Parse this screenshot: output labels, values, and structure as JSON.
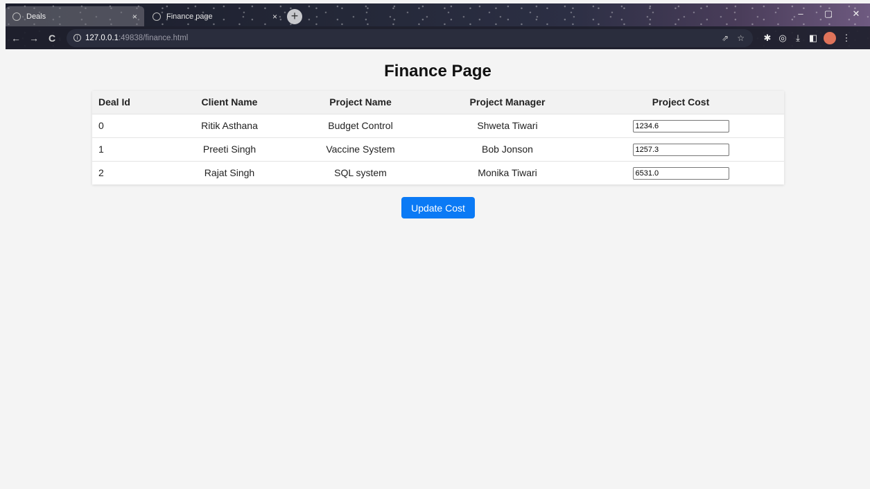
{
  "browser": {
    "tabs": [
      {
        "title": "Deals",
        "close": "×"
      },
      {
        "title": "Finance page",
        "close": "×"
      }
    ],
    "new_tab": "+",
    "window_controls": {
      "minimize": "–",
      "maximize": "▢",
      "close": "✕"
    },
    "address": {
      "host": "127.0.0.1",
      "path": ":49838/finance.html"
    },
    "nav": {
      "back": "←",
      "forward": "→",
      "reload": "C"
    }
  },
  "page": {
    "title": "Finance Page",
    "table": {
      "headers": [
        "Deal Id",
        "Client Name",
        "Project Name",
        "Project Manager",
        "Project Cost"
      ],
      "rows": [
        {
          "id": "0",
          "client": "Ritik Asthana",
          "project": "Budget Control",
          "manager": "Shweta Tiwari",
          "cost": "1234.6"
        },
        {
          "id": "1",
          "client": "Preeti Singh",
          "project": "Vaccine System",
          "manager": "Bob Jonson",
          "cost": "1257.3"
        },
        {
          "id": "2",
          "client": "Rajat Singh",
          "project": "SQL system",
          "manager": "Monika Tiwari",
          "cost": "6531.0"
        }
      ]
    },
    "update_button": "Update Cost"
  },
  "colors": {
    "accent": "#0b7af5",
    "page_bg": "#f4f4f4"
  }
}
